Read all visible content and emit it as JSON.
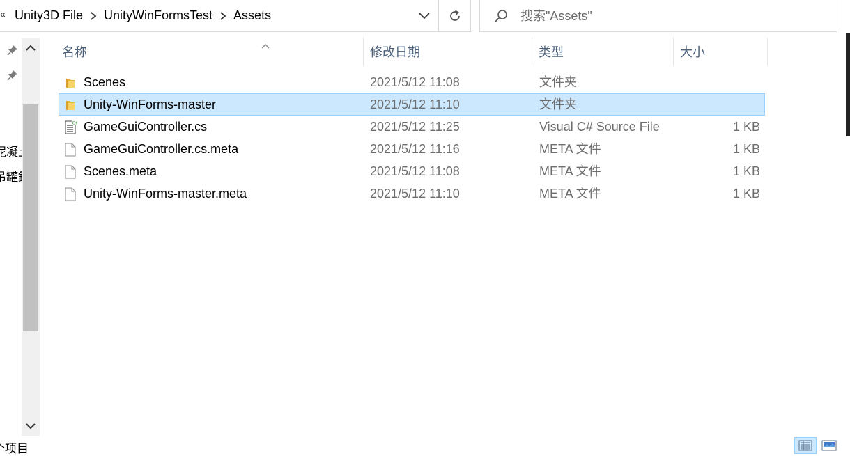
{
  "address_bar": {
    "overflow": "«",
    "breadcrumbs": [
      "Unity3D File",
      "UnityWinFormsTest",
      "Assets"
    ]
  },
  "search": {
    "placeholder": "搜索\"Assets\""
  },
  "nav_pane": {
    "items": [
      "泥凝土",
      "吊罐鈕"
    ]
  },
  "columns": {
    "name": "名称",
    "date": "修改日期",
    "type": "类型",
    "size": "大小"
  },
  "files": [
    {
      "name": "Scenes",
      "date": "2021/5/12 11:08",
      "type": "文件夹",
      "size": "",
      "icon": "folder-icon",
      "selected": false
    },
    {
      "name": "Unity-WinForms-master",
      "date": "2021/5/12 11:10",
      "type": "文件夹",
      "size": "",
      "icon": "folder-icon",
      "selected": true
    },
    {
      "name": "GameGuiController.cs",
      "date": "2021/5/12 11:25",
      "type": "Visual C# Source File",
      "size": "1 KB",
      "icon": "csharp-file-icon",
      "selected": false
    },
    {
      "name": "GameGuiController.cs.meta",
      "date": "2021/5/12 11:16",
      "type": "META 文件",
      "size": "1 KB",
      "icon": "file-icon",
      "selected": false
    },
    {
      "name": "Scenes.meta",
      "date": "2021/5/12 11:08",
      "type": "META 文件",
      "size": "1 KB",
      "icon": "file-icon",
      "selected": false
    },
    {
      "name": "Unity-WinForms-master.meta",
      "date": "2021/5/12 11:10",
      "type": "META 文件",
      "size": "1 KB",
      "icon": "file-icon",
      "selected": false
    }
  ],
  "status_bar": {
    "text": "个项目"
  },
  "colors": {
    "selection_bg": "#cce8ff",
    "selection_border": "#99d1ff",
    "header_text": "#4c607a",
    "secondary_text": "#6d6d6d",
    "folder": "#f5c542"
  }
}
